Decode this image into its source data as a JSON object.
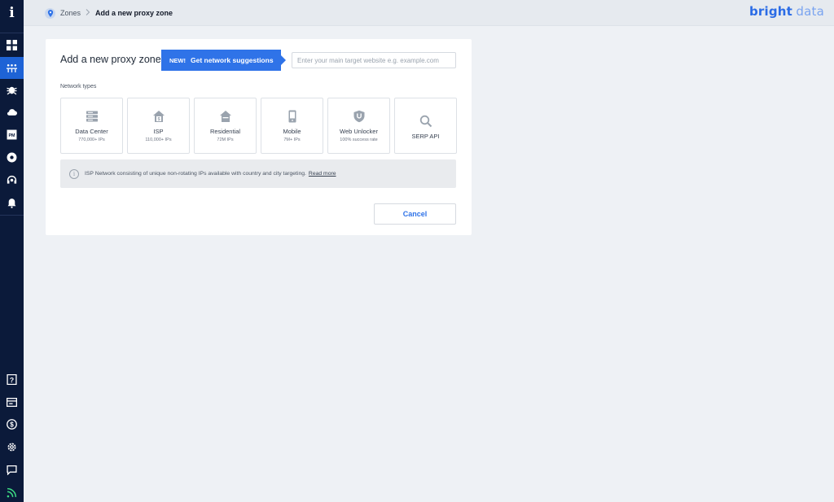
{
  "sidebar": {
    "top_glyph": "i",
    "items": [
      {
        "name": "dashboard-icon"
      },
      {
        "name": "proxies-icon",
        "active": true
      },
      {
        "name": "scraper-icon"
      },
      {
        "name": "cloud-icon"
      },
      {
        "name": "pm-icon"
      },
      {
        "name": "browser-icon"
      },
      {
        "name": "support-icon"
      },
      {
        "name": "bell-icon"
      }
    ],
    "bottom_items": [
      {
        "name": "help-icon"
      },
      {
        "name": "billing-card-icon"
      },
      {
        "name": "dollar-icon"
      },
      {
        "name": "gear-icon"
      },
      {
        "name": "chat-icon"
      },
      {
        "name": "rss-icon"
      }
    ]
  },
  "breadcrumb": {
    "parent": "Zones",
    "separator": ">",
    "current": "Add a new proxy zone"
  },
  "brand": {
    "part1": "bright",
    "part2": "data"
  },
  "card": {
    "title": "Add a new proxy zone",
    "suggest": {
      "new_label": "NEW!",
      "label": "Get network suggestions"
    },
    "url_input": {
      "placeholder": "Enter your main target website e.g. example.com",
      "value": ""
    },
    "network_types_label": "Network types",
    "tiles": [
      {
        "name": "Data Center",
        "sub": "770,000+ IPs",
        "icon": "server-icon"
      },
      {
        "name": "ISP",
        "sub": "110,000+ IPs",
        "icon": "isp-house-icon"
      },
      {
        "name": "Residential",
        "sub": "72M IPs",
        "icon": "house-icon"
      },
      {
        "name": "Mobile",
        "sub": "7M+ IPs",
        "icon": "mobile-icon"
      },
      {
        "name": "Web Unlocker",
        "sub": "100% success rate",
        "icon": "unlocker-shield-icon"
      },
      {
        "name": "SERP API",
        "sub": "",
        "icon": "search-icon"
      }
    ],
    "info": {
      "text": "ISP Network consisting of unique non-rotating IPs available with country and city targeting.",
      "link": "Read more"
    },
    "cancel_label": "Cancel"
  },
  "colors": {
    "sidebar_bg": "#0b1a3a",
    "accent": "#2f73e8",
    "page_bg": "#eef1f5"
  }
}
